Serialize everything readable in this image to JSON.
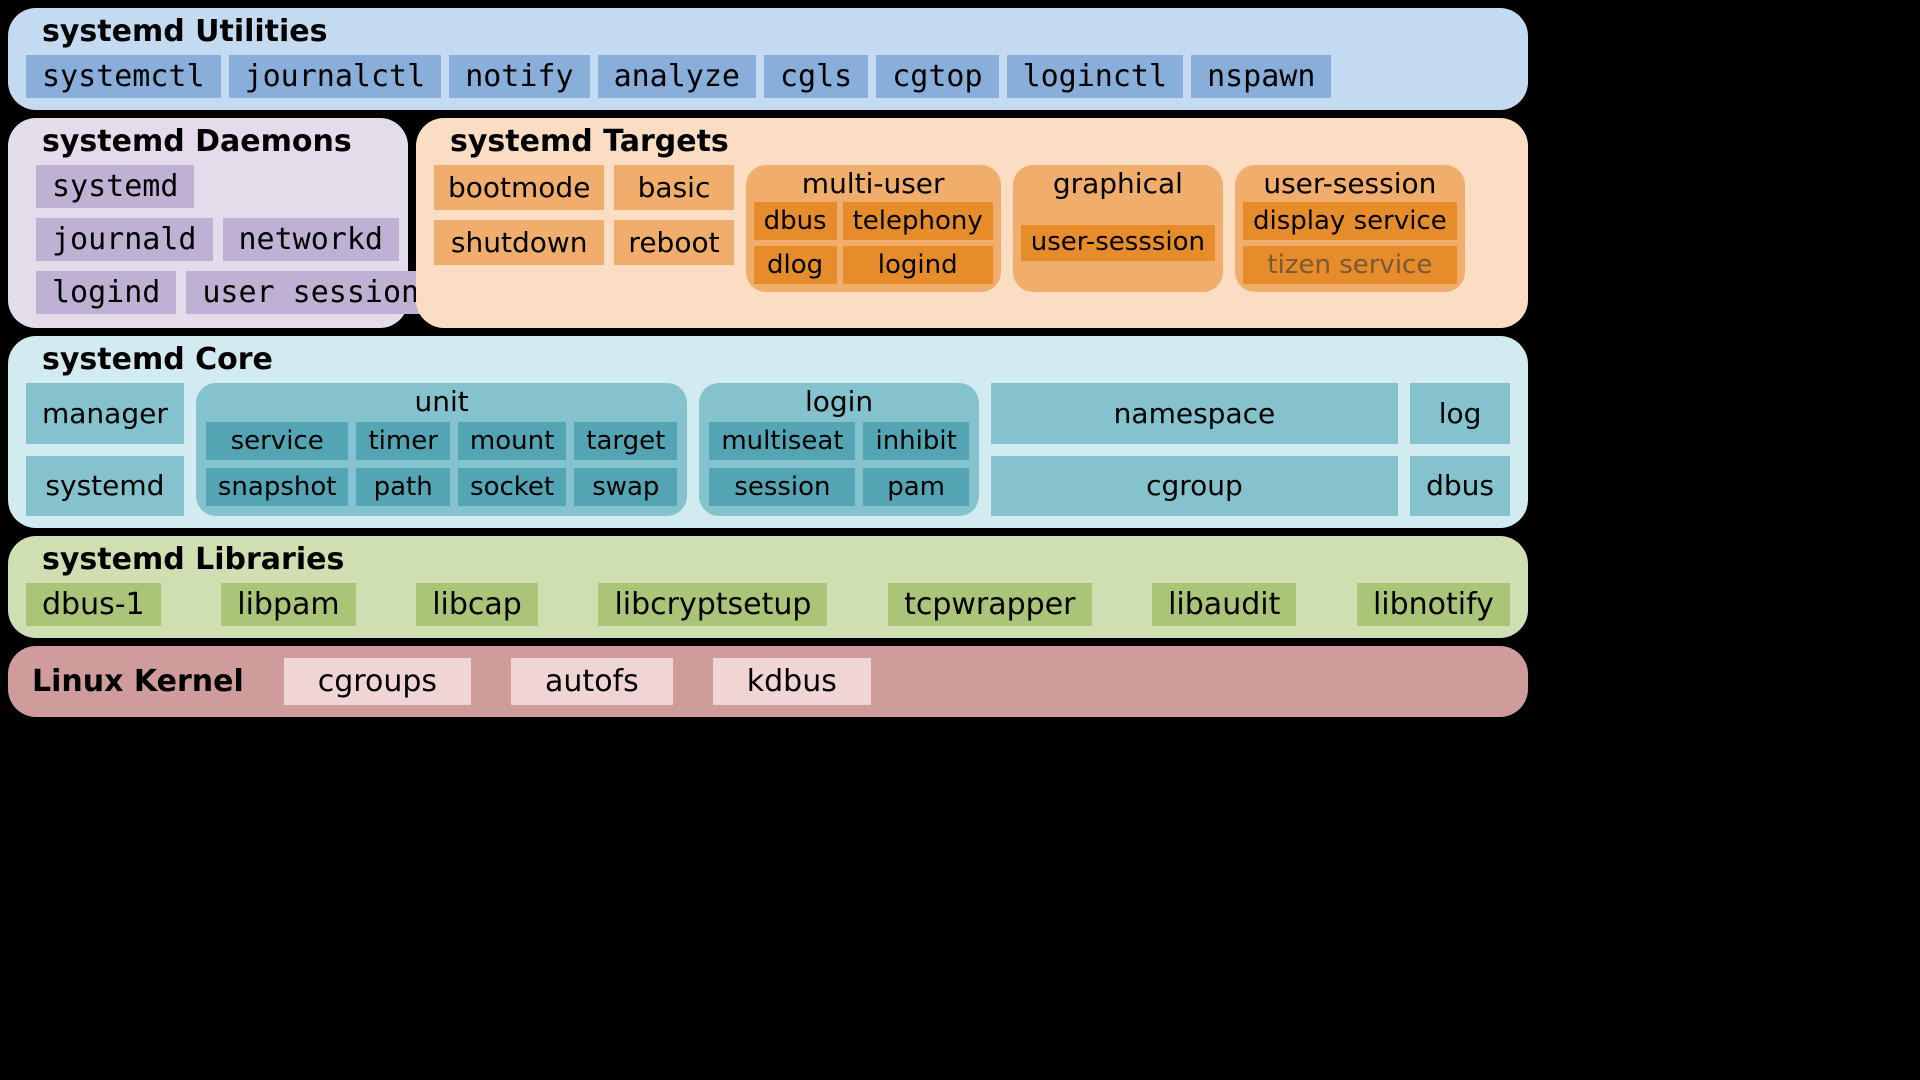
{
  "utilities": {
    "title": "systemd Utilities",
    "items": [
      "systemctl",
      "journalctl",
      "notify",
      "analyze",
      "cgls",
      "cgtop",
      "loginctl",
      "nspawn"
    ]
  },
  "daemons": {
    "title": "systemd Daemons",
    "rows": [
      [
        "systemd"
      ],
      [
        "journald",
        "networkd"
      ],
      [
        "logind",
        "user session"
      ]
    ]
  },
  "targets": {
    "title": "systemd Targets",
    "basic": [
      "bootmode",
      "basic",
      "shutdown",
      "reboot"
    ],
    "groups": [
      {
        "title": "multi-user",
        "items": [
          "dbus",
          "telephony",
          "dlog",
          "logind"
        ]
      },
      {
        "title": "graphical",
        "items": [
          "user-sesssion"
        ]
      },
      {
        "title": "user-session",
        "items": [
          "display service",
          "tizen service"
        ],
        "dim": [
          1
        ]
      }
    ]
  },
  "core": {
    "title": "systemd Core",
    "left": [
      "manager",
      "systemd"
    ],
    "unit": {
      "title": "unit",
      "items": [
        "service",
        "timer",
        "mount",
        "target",
        "snapshot",
        "path",
        "socket",
        "swap"
      ]
    },
    "login": {
      "title": "login",
      "items": [
        "multiseat",
        "inhibit",
        "session",
        "pam"
      ]
    },
    "right1": [
      "namespace",
      "log"
    ],
    "right2": [
      "cgroup",
      "dbus"
    ]
  },
  "libs": {
    "title": "systemd Libraries",
    "items": [
      "dbus-1",
      "libpam",
      "libcap",
      "libcryptsetup",
      "tcpwrapper",
      "libaudit",
      "libnotify"
    ]
  },
  "kernel": {
    "title": "Linux Kernel",
    "items": [
      "cgroups",
      "autofs",
      "kdbus"
    ]
  }
}
